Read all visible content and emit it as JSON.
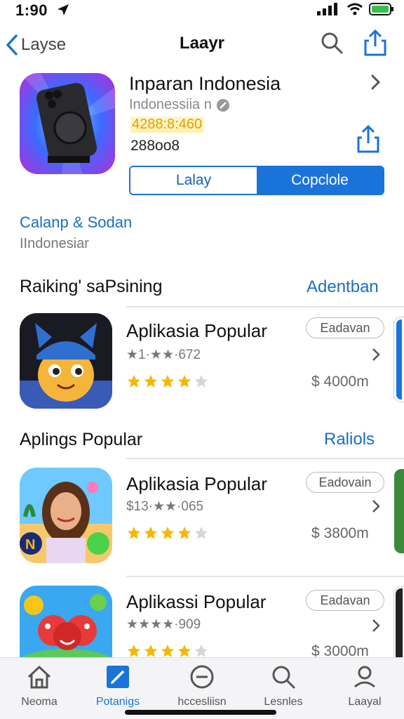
{
  "status": {
    "time": "1:90"
  },
  "nav": {
    "back_label": "Layse",
    "title": "Laayr"
  },
  "app": {
    "title": "Inparan Indonesia",
    "subtitle": "Indonessiia n",
    "code": "4288:8:460",
    "number": "288oo8",
    "seg_left": "Lalay",
    "seg_right": "Copclole",
    "category": "Calanp & Sodan",
    "category_sub": "IIndonesiar"
  },
  "section1": {
    "title": "Raiking' saPsining",
    "link": "Adentban"
  },
  "section2": {
    "title": "Aplings Popular",
    "link": "Raliols"
  },
  "rows": [
    {
      "name": "Aplikasia Popular",
      "rating": "★1·★★·672",
      "pill": "Eadavan",
      "price": "$ 4000m",
      "stars": 4
    },
    {
      "name": "Aplikasia Popular",
      "rating": "$13·★★·065",
      "pill": "Eadovain",
      "price": "$ 3800m",
      "stars": 4
    },
    {
      "name": "Aplikassi Popular",
      "rating": "★★★★·909",
      "pill": "Eadavan",
      "price": "$ 3000m",
      "stars": 4
    }
  ],
  "tabs": [
    {
      "label": "Neoma",
      "icon": "house-icon",
      "active": false
    },
    {
      "label": "Potanigs",
      "icon": "edit-icon",
      "active": true
    },
    {
      "label": "hccesliisn",
      "icon": "minus-circle-icon",
      "active": false
    },
    {
      "label": "Lesnles",
      "icon": "search-icon",
      "active": false
    },
    {
      "label": "Laayal",
      "icon": "person-icon",
      "active": false
    }
  ],
  "colors": {
    "accent": "#1a73d9",
    "star": "#f5b800",
    "code_highlight": "#e0a000"
  }
}
